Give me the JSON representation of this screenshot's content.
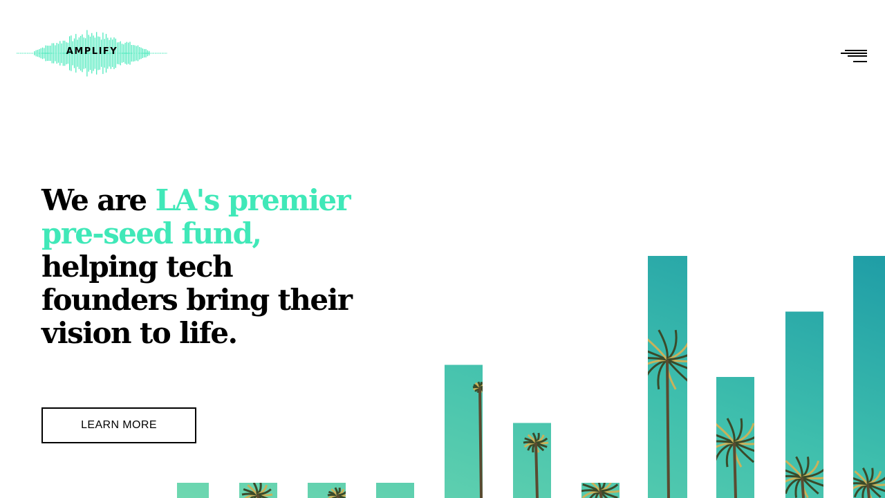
{
  "header": {
    "logo_text": "AMPLIFY",
    "logo_icon": "waveform-icon",
    "menu_icon": "hamburger-menu-icon"
  },
  "hero": {
    "headline": {
      "part1": "We are ",
      "accent": "LA's premier pre-seed fund,",
      "part2": " helping tech founders bring their vision to life."
    },
    "cta_label": "LEARN MORE"
  },
  "decor": {
    "image_subject": "palm trees against teal sky",
    "bar_heights_fraction": [
      0.06,
      0.06,
      0.06,
      0.06,
      0.55,
      0.31,
      0.06,
      1.0,
      0.5,
      0.77,
      1.0
    ]
  },
  "colors": {
    "accent": "#40e8b8",
    "text": "#000000",
    "background": "#ffffff",
    "bar_teal_light": "#5fd1b0",
    "bar_teal_dark": "#1f9ea4"
  }
}
